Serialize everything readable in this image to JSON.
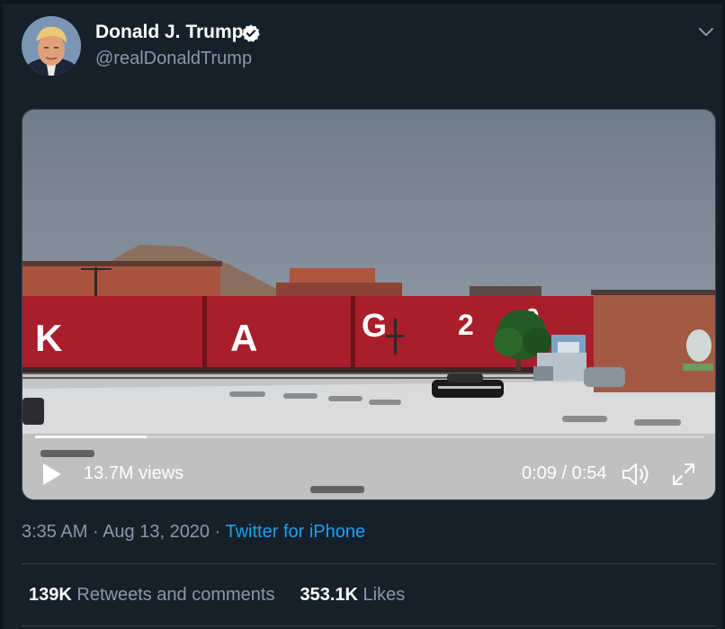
{
  "tweet": {
    "author_name": "Donald J. Trump",
    "author_handle": "@realDonaldTrump",
    "time": "3:35 AM",
    "sep1": " · ",
    "date": "Aug 13, 2020",
    "sep2": " · ",
    "source": "Twitter for iPhone"
  },
  "video": {
    "views": "13.7M views",
    "current_time": "0:09",
    "time_sep": " / ",
    "duration": "0:54",
    "progress": 0.167,
    "boxcar_letters": [
      "K",
      "A",
      "G",
      "2",
      "0"
    ]
  },
  "stats": {
    "retweets_count": "139K",
    "retweets_label": "Retweets and comments",
    "likes_count": "353.1K",
    "likes_label": "Likes"
  },
  "colors": {
    "background": "#15202b",
    "link": "#1da1f2",
    "secondary_text": "#8899a6",
    "border": "#38444d"
  },
  "icons": {
    "verified": "verified-badge-icon",
    "menu": "chevron-down-icon",
    "play": "play-icon",
    "volume": "volume-icon",
    "fullscreen": "fullscreen-icon"
  }
}
